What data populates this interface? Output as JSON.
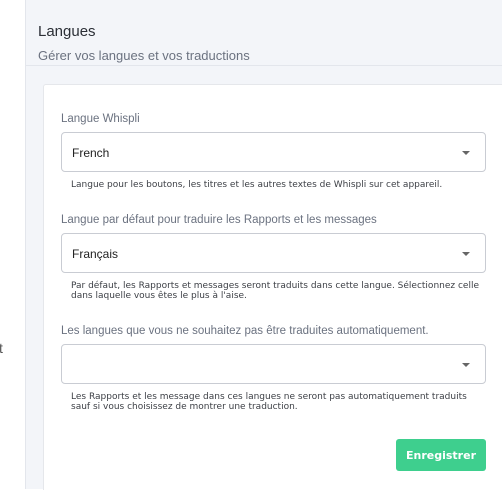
{
  "edge": {
    "left_fragment": "t"
  },
  "panel": {
    "title": "Langues",
    "subtitle": "Gérer vos langues et vos traductions"
  },
  "fields": [
    {
      "label": "Langue Whispli",
      "value": "French",
      "helper": "Langue pour les boutons, les titres et les autres textes de Whispli sur cet appareil."
    },
    {
      "label": "Langue par défaut pour traduire les Rapports et les messages",
      "value": "Français",
      "helper": "Par défaut, les Rapports et messages seront traduits dans cette langue. Sélectionnez celle dans laquelle vous êtes le plus à l'aise."
    },
    {
      "label": "Les langues que vous ne souhaitez pas être traduites automatiquement.",
      "value": "",
      "helper": "Les Rapports et les message dans ces langues ne seront pas automatiquement traduits sauf si vous choisissez de montrer une traduction."
    }
  ],
  "actions": {
    "save_label": "Enregistrer"
  },
  "colors": {
    "accent": "#3ecf8e",
    "panel_bg": "#f3f5f9"
  },
  "icons": [
    "chevron-down-icon"
  ]
}
